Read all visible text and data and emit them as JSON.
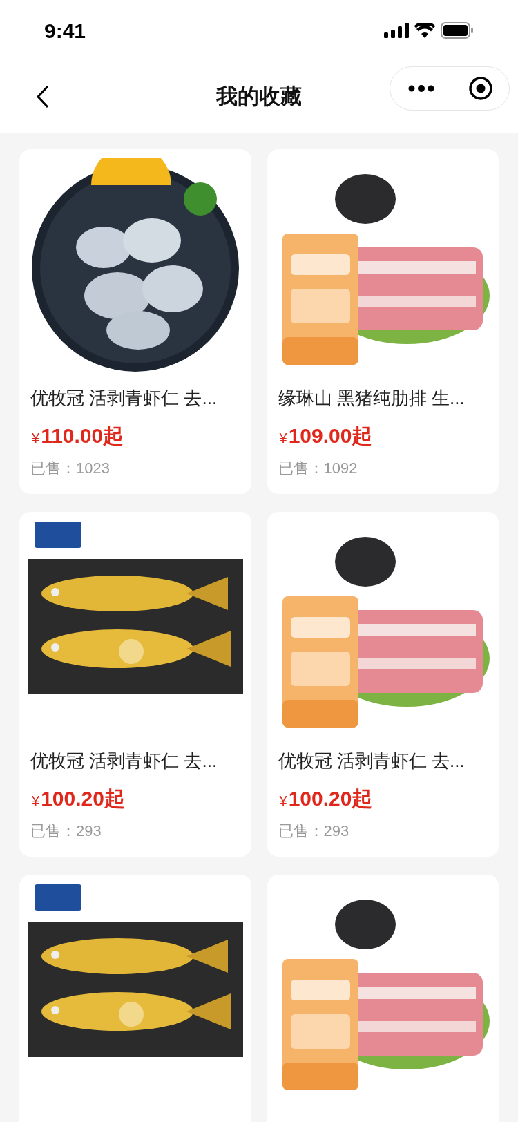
{
  "status_bar": {
    "time": "9:41"
  },
  "nav": {
    "title": "我的收藏"
  },
  "products": [
    {
      "kind": "shrimp",
      "title": "优牧冠 活剥青虾仁 去...",
      "currency": "¥",
      "price": "110.00起",
      "sold": "已售：1023"
    },
    {
      "kind": "pork",
      "title": "缘琳山 黑猪纯肋排 生...",
      "currency": "¥",
      "price": "109.00起",
      "sold": "已售：1092"
    },
    {
      "kind": "fish",
      "title": "优牧冠 活剥青虾仁 去...",
      "currency": "¥",
      "price": "100.20起",
      "sold": "已售：293"
    },
    {
      "kind": "pork",
      "title": "优牧冠 活剥青虾仁 去...",
      "currency": "¥",
      "price": "100.20起",
      "sold": "已售：293"
    },
    {
      "kind": "fish"
    },
    {
      "kind": "pork"
    }
  ]
}
